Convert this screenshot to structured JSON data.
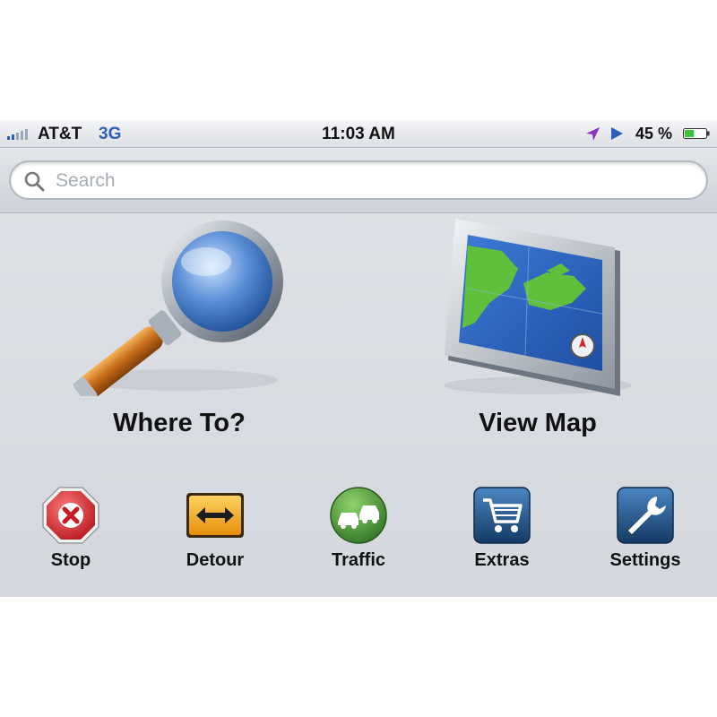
{
  "status_bar": {
    "carrier": "AT&T",
    "network": "3G",
    "time": "11:03 AM",
    "battery_percent": "45 %",
    "battery_level": 0.45,
    "signal_bars": 2,
    "icons": [
      "signal-icon",
      "location-arrow-icon",
      "play-icon",
      "battery-icon"
    ],
    "colors": {
      "network": "#2e5fb7",
      "location_arrow": "#8b2fc9",
      "battery_fill": "#3cc23c"
    }
  },
  "search": {
    "placeholder": "Search",
    "icon": "search-icon"
  },
  "main_tiles": [
    {
      "label": "Where To?",
      "icon": "magnifying-glass-icon"
    },
    {
      "label": "View Map",
      "icon": "map-monitor-icon"
    }
  ],
  "quick_buttons": [
    {
      "label": "Stop",
      "icon": "stop-icon",
      "color": "#d0262b"
    },
    {
      "label": "Detour",
      "icon": "detour-icon",
      "color": "#f0a81c"
    },
    {
      "label": "Traffic",
      "icon": "traffic-icon",
      "color": "#3e8e34"
    },
    {
      "label": "Extras",
      "icon": "cart-icon",
      "color": "#1f4e79"
    },
    {
      "label": "Settings",
      "icon": "wrench-icon",
      "color": "#1f4e79"
    }
  ]
}
